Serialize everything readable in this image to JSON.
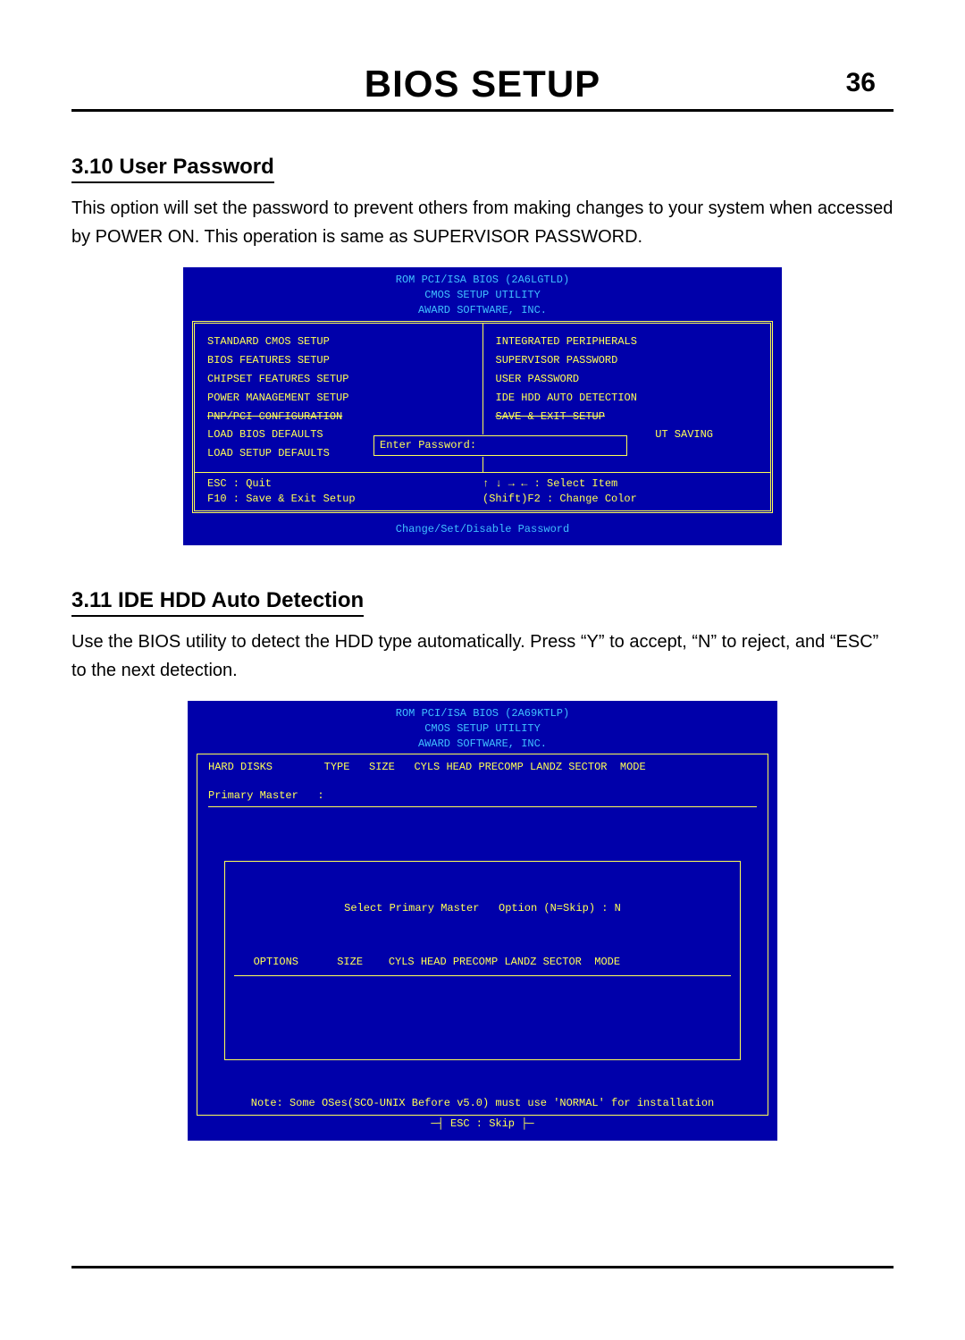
{
  "header": {
    "title": "BIOS SETUP",
    "page": "36"
  },
  "section1": {
    "heading": "3.10 User Password",
    "body": "This option will set the password to prevent others from making changes to your system when accessed by POWER ON. This operation is same as SUPERVISOR PASSWORD."
  },
  "bios1": {
    "title1": "ROM PCI/ISA BIOS (2A6LGTLD)",
    "title2": "CMOS SETUP UTILITY",
    "title3": "AWARD SOFTWARE, INC.",
    "left": [
      "STANDARD CMOS SETUP",
      "BIOS FEATURES SETUP",
      "CHIPSET FEATURES SETUP",
      "POWER MANAGEMENT SETUP",
      "PNP/PCI CONFIGURATION",
      "LOAD BIOS DEFAULTS",
      "LOAD SETUP DEFAULTS"
    ],
    "right": [
      "INTEGRATED PERIPHERALS",
      "SUPERVISOR PASSWORD",
      "USER PASSWORD",
      "IDE HDD AUTO DETECTION",
      "SAVE & EXIT SETUP",
      "UT SAVING"
    ],
    "popup": "Enter Password:",
    "footL1": "ESC : Quit",
    "footL2": "F10 : Save & Exit Setup",
    "footR1": "↑ ↓ → ←   : Select Item",
    "footR2": "(Shift)F2 : Change Color",
    "bottom": "Change/Set/Disable Password"
  },
  "section2": {
    "heading": " 3.11 IDE HDD Auto Detection",
    "body": "Use the BIOS utility to detect the HDD type automatically. Press “Y” to accept,  “N” to reject, and “ESC” to the next detection."
  },
  "bios2": {
    "title1": "ROM PCI/ISA BIOS (2A69KTLP)",
    "title2": "CMOS SETUP UTILITY",
    "title3": "AWARD SOFTWARE, INC.",
    "hdr": "HARD DISKS        TYPE   SIZE   CYLS HEAD PRECOMP LANDZ SECTOR  MODE",
    "pm": "Primary Master   :",
    "select": "Select Primary Master   Option (N=Skip) : N",
    "opts": "   OPTIONS      SIZE    CYLS HEAD PRECOMP LANDZ SECTOR  MODE",
    "note": "Note: Some OSes(SCO-UNIX Before v5.0) must use 'NORMAL' for installation",
    "esc": "─┤ ESC : Skip ├─"
  }
}
